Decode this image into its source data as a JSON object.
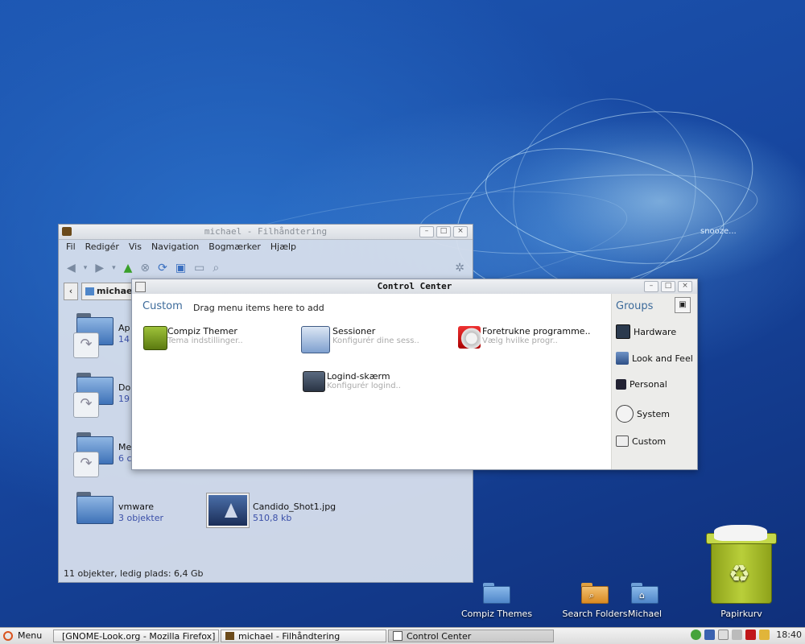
{
  "desktop": {
    "snooze_text": "snooze...",
    "icons": [
      {
        "label": "Compiz Themes",
        "icon": "folder-icon"
      },
      {
        "label": "Search Folders",
        "icon": "search-folder-icon"
      },
      {
        "label": "Michael",
        "icon": "home-folder-icon"
      },
      {
        "label": "Papirkurv",
        "icon": "trash-icon"
      }
    ]
  },
  "file_manager": {
    "title": "michael - Filhåndtering",
    "menu": [
      "Fil",
      "Redigér",
      "Vis",
      "Navigation",
      "Bogmærker",
      "Hjælp"
    ],
    "location": "michae",
    "items": [
      {
        "name": "Ap",
        "sub": "14"
      },
      {
        "name": "Do",
        "sub": "19"
      },
      {
        "name": "Me",
        "sub": "6 c"
      },
      {
        "name": "vmware",
        "sub": "3 objekter"
      },
      {
        "name": "Candido_Shot1.jpg",
        "sub": "510,8 kb"
      }
    ],
    "status": "11 objekter, ledig plads: 6,4 Gb"
  },
  "control_center": {
    "title": "Control Center",
    "custom_title": "Custom",
    "custom_hint": "Drag menu items here to add",
    "items": [
      {
        "name": "Compiz Themer",
        "desc": "Tema indstillinger.."
      },
      {
        "name": "Sessioner",
        "desc": "Konfigurér dine sess.."
      },
      {
        "name": "Foretrukne programme..",
        "desc": "Vælg hvilke progr.."
      },
      {
        "name": "Logind-skærm",
        "desc": "Konfigurér logind.."
      }
    ],
    "groups_title": "Groups",
    "groups": [
      "Hardware",
      "Look and Feel",
      "Personal",
      "System",
      "Custom"
    ]
  },
  "panel": {
    "menu_label": "Menu",
    "tasks": [
      {
        "label": "[GNOME-Look.org - Mozilla Firefox]"
      },
      {
        "label": "michael - Filhåndtering"
      },
      {
        "label": "Control Center"
      }
    ],
    "clock": "18:40"
  }
}
